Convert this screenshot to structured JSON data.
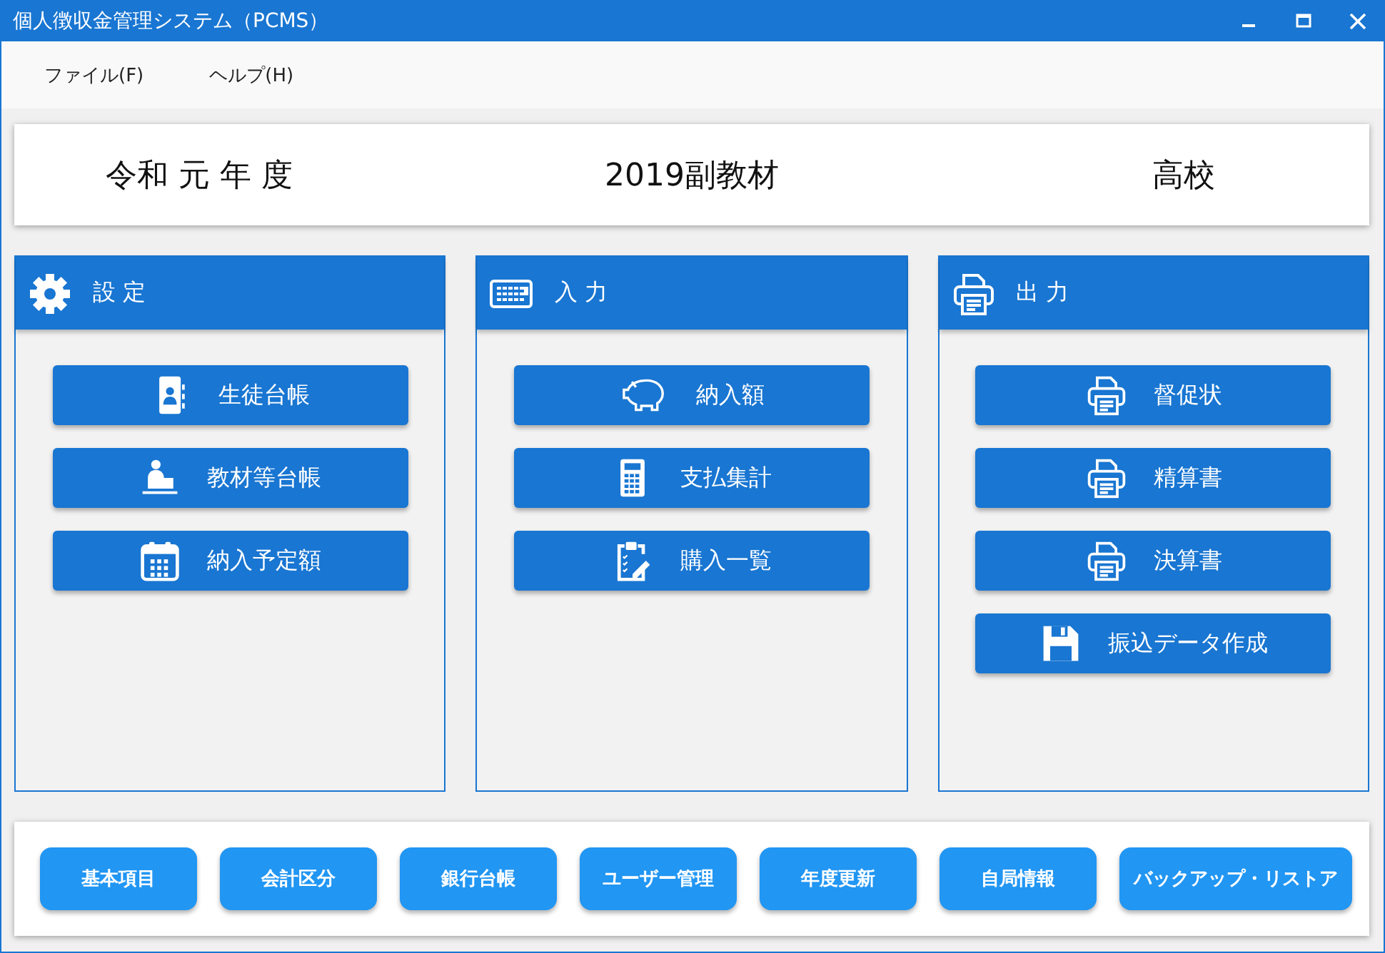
{
  "window": {
    "title": "個人徴収金管理システム（PCMS）"
  },
  "menu": [
    {
      "label": "ファイル(F)"
    },
    {
      "label": "ヘルプ(H)"
    }
  ],
  "header": {
    "era": "令和 元 年 度",
    "subject": "2019副教材",
    "school": "高校"
  },
  "panels": [
    {
      "title": "設 定",
      "kind": "gear",
      "buttons": [
        {
          "label": "生徒台帳",
          "kind": "contact-book"
        },
        {
          "label": "教材等台帳",
          "kind": "person-desk"
        },
        {
          "label": "納入予定額",
          "kind": "calendar"
        }
      ]
    },
    {
      "title": "入 力",
      "kind": "keyboard",
      "buttons": [
        {
          "label": "納入額",
          "kind": "piggy-bank"
        },
        {
          "label": "支払集計",
          "kind": "calculator"
        },
        {
          "label": "購入一覧",
          "kind": "clipboard"
        }
      ]
    },
    {
      "title": "出 力",
      "kind": "printer",
      "buttons": [
        {
          "label": "督促状",
          "kind": "printer"
        },
        {
          "label": "精算書",
          "kind": "printer"
        },
        {
          "label": "決算書",
          "kind": "printer"
        },
        {
          "label": "振込データ作成",
          "kind": "floppy"
        }
      ]
    }
  ],
  "footer_buttons": [
    "基本項目",
    "会計区分",
    "銀行台帳",
    "ユーザー管理",
    "年度更新",
    "自局情報",
    "バックアップ・リストア"
  ]
}
